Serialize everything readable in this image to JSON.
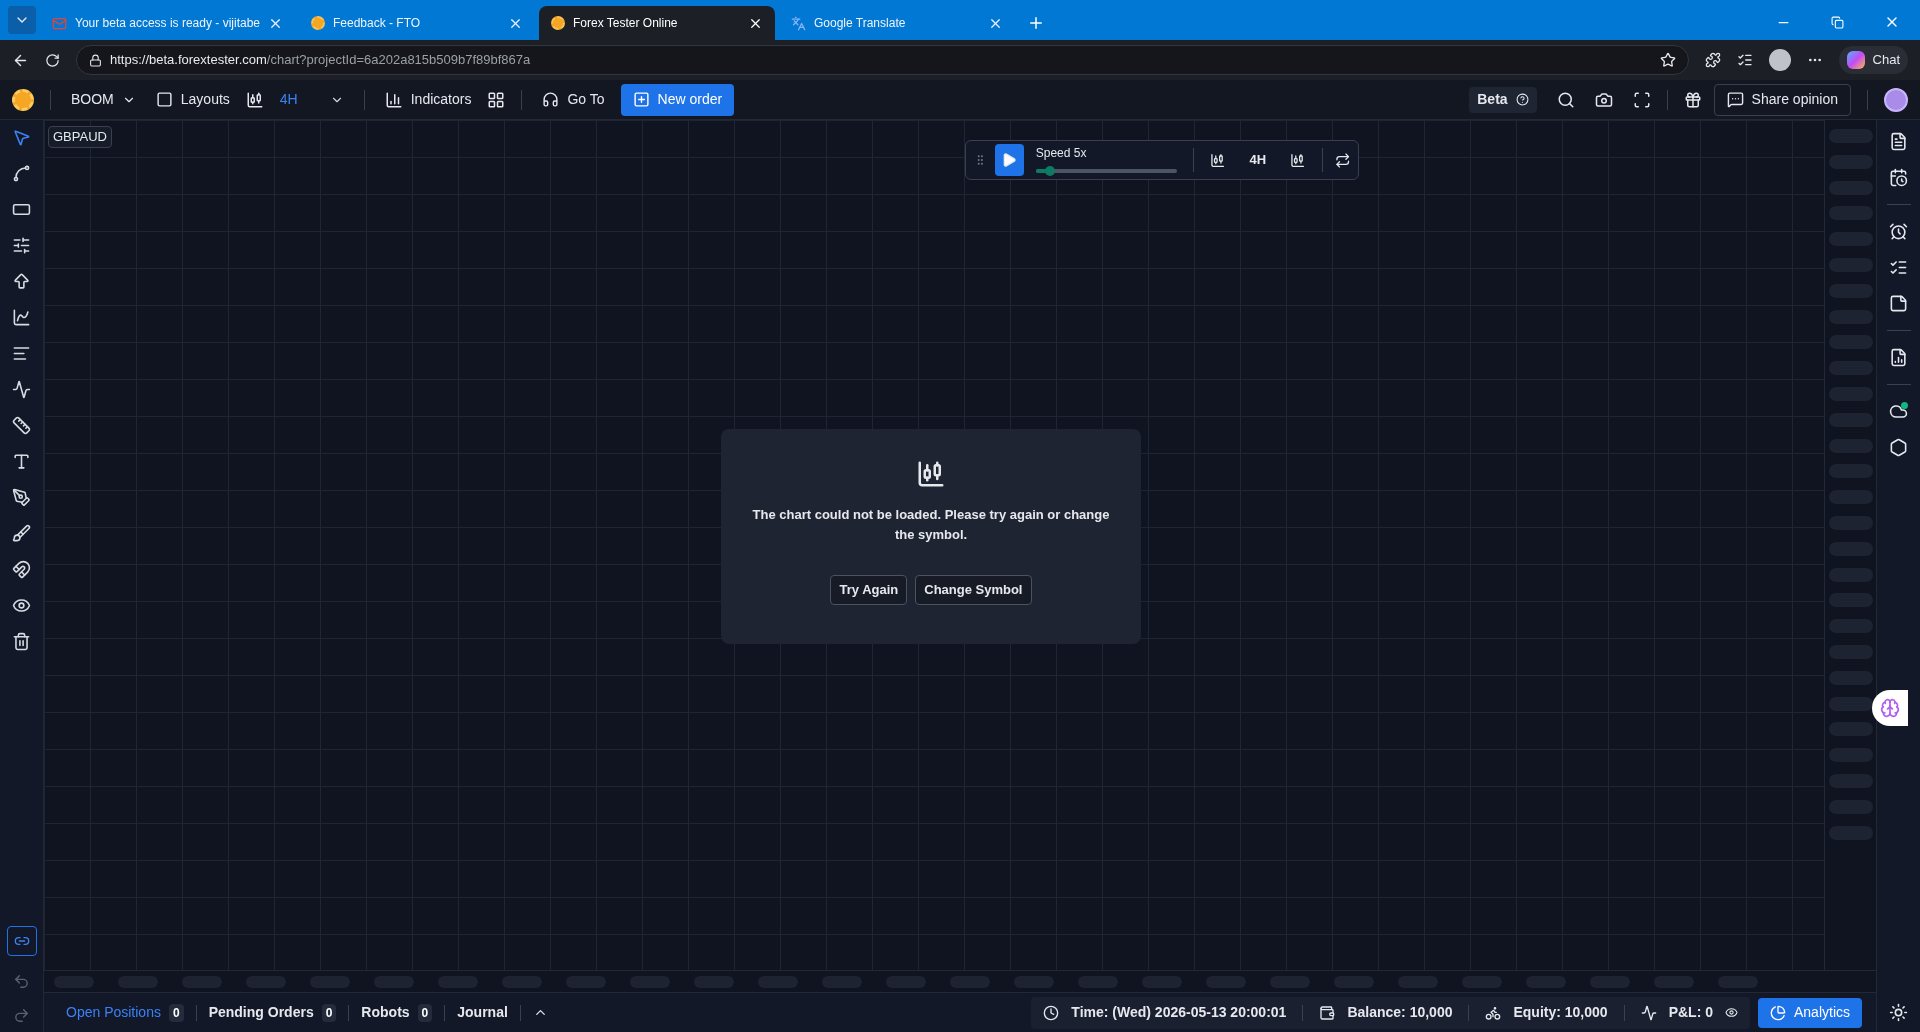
{
  "browser": {
    "tabs": [
      {
        "title": "Your beta access is ready - vijitabe",
        "selected": false,
        "kind": "mail"
      },
      {
        "title": "Feedback - FTO",
        "selected": false,
        "kind": "site"
      },
      {
        "title": "Forex Tester Online",
        "selected": true,
        "kind": "site"
      },
      {
        "title": "Google Translate",
        "selected": false,
        "kind": "translate"
      }
    ],
    "url_host": "https://beta.forextester.com",
    "url_path": "/chart?projectId=6a202a815b509b7f89bf867a",
    "chat": "Chat"
  },
  "toolbar": {
    "symbol": "BOOM",
    "layouts": "Layouts",
    "timeframe": "4H",
    "indicators": "Indicators",
    "go_to": "Go To",
    "new_order": "New order",
    "beta": "Beta",
    "share": "Share opinion"
  },
  "chart": {
    "symbol": "GBPAUD",
    "playback": {
      "speed": "Speed 5x",
      "level": 0.1,
      "timeframe": "4H"
    },
    "error": {
      "message": "The chart could not be loaded. Please try again or change the symbol.",
      "buttons": [
        "Try Again",
        "Change Symbol"
      ]
    }
  },
  "left_tools": [
    {
      "selected": true
    },
    {
      "selected": false
    },
    {
      "selected": false
    },
    {
      "selected": false
    },
    {
      "selected": false
    },
    {
      "selected": false
    },
    {
      "selected": false
    },
    {
      "selected": false
    },
    {
      "selected": false
    },
    {
      "selected": false
    },
    {
      "selected": false
    },
    {
      "selected": false
    },
    {
      "selected": false
    },
    {
      "selected": false
    },
    {
      "selected": false
    }
  ],
  "bottom_tabs": [
    {
      "label": "Open Positions",
      "count": "0",
      "selected": true
    },
    {
      "label": "Pending Orders",
      "count": "0",
      "selected": false
    },
    {
      "label": "Robots",
      "count": "0",
      "selected": false
    },
    {
      "label": "Journal",
      "selected": false
    }
  ],
  "status": {
    "time": "Time: (Wed) 2026-05-13 20:00:01",
    "balance": "Balance: 10,000",
    "equity": "Equity: 10,000",
    "pnl": "P&L: 0",
    "analytics": "Analytics"
  }
}
